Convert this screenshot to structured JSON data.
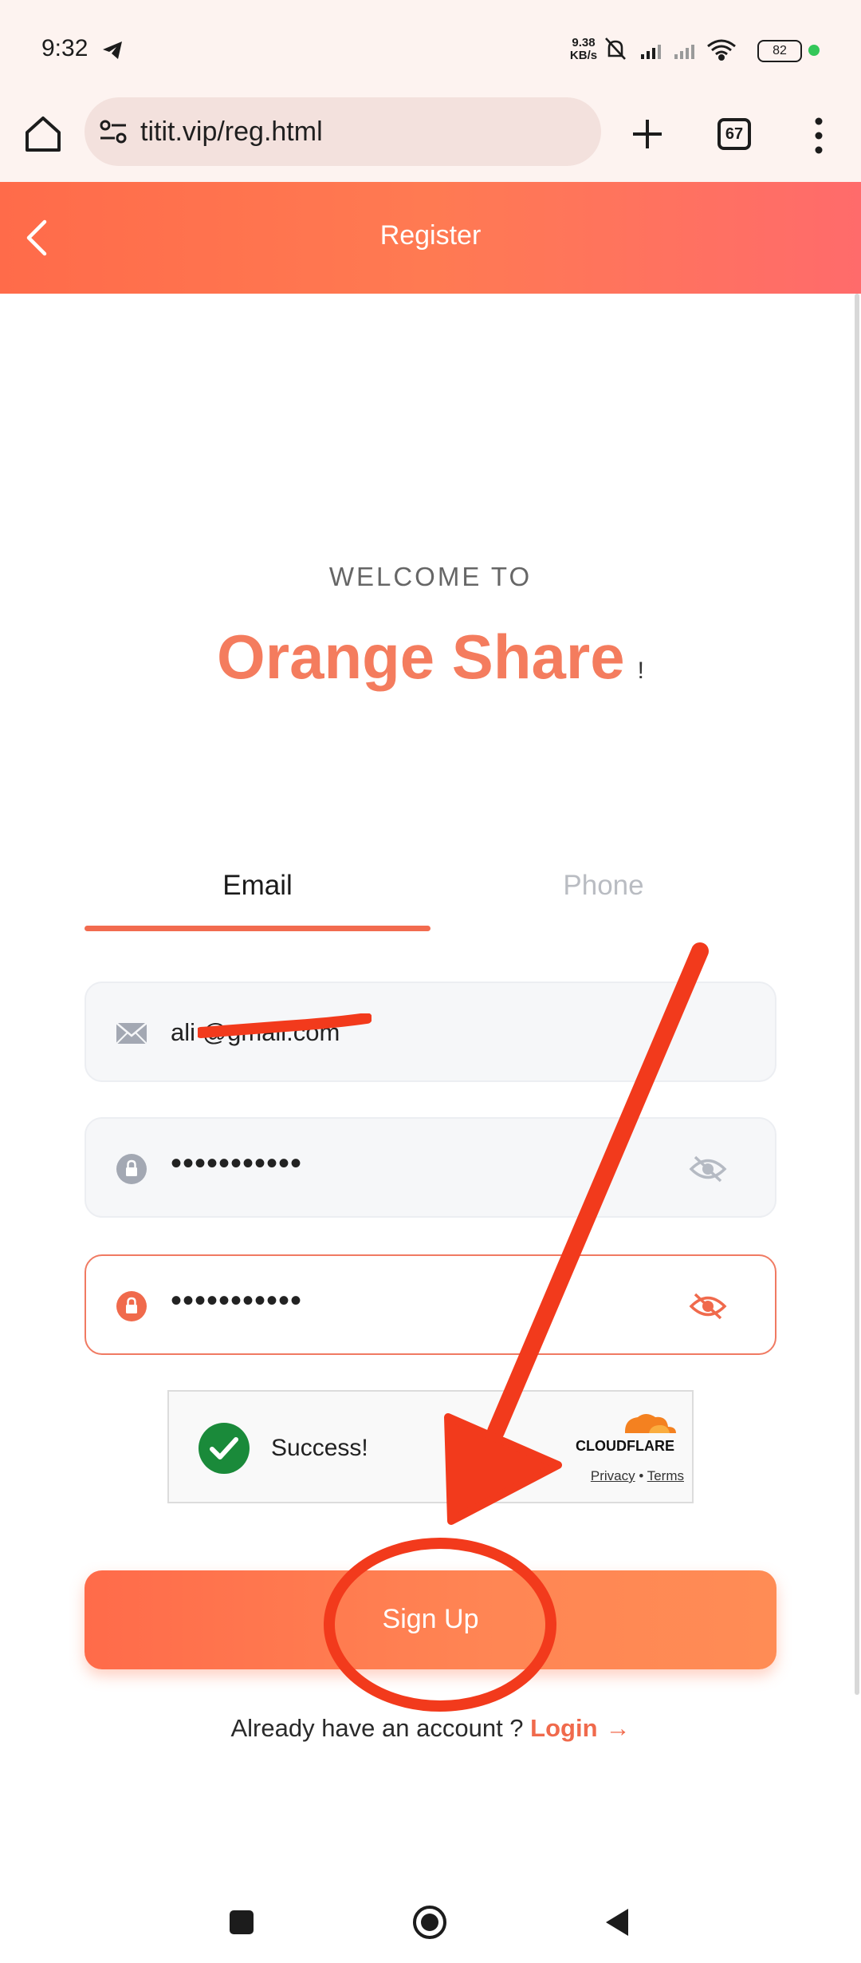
{
  "status_bar": {
    "time": "9:32",
    "net_speed_value": "9.38",
    "net_speed_unit": "KB/s",
    "battery": "82"
  },
  "browser": {
    "url": "titit.vip/reg.html",
    "tab_count": "67"
  },
  "header": {
    "title": "Register"
  },
  "welcome": {
    "line": "WELCOME TO",
    "brand": "Orange Share",
    "exclaim": "!"
  },
  "tabs": {
    "email": "Email",
    "phone": "Phone"
  },
  "form": {
    "email_value": "ali       @gmail.com",
    "password_value": "•••••••••••",
    "confirm_value": "•••••••••••"
  },
  "captcha": {
    "status": "Success!",
    "brand": "CLOUDFLARE",
    "privacy": "Privacy",
    "separator": "•",
    "terms": "Terms"
  },
  "signup_button": {
    "label": "Sign Up"
  },
  "login_prompt": {
    "text": "Already have an account ? ",
    "link": "Login",
    "arrow": "→"
  },
  "colors": {
    "accent": "#f26b4f",
    "annotation": "#f23a1c"
  }
}
